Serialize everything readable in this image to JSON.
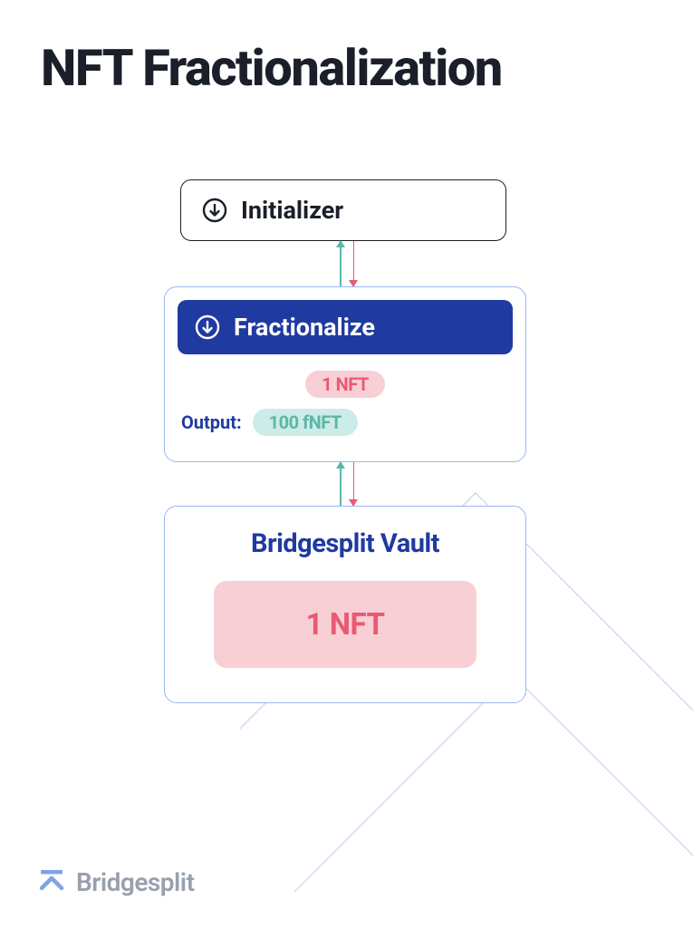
{
  "title": "NFT Fractionalization",
  "initializer": {
    "label": "Initializer"
  },
  "fractionalize": {
    "header_label": "Fractionalize",
    "input_pill": "1 NFT",
    "output_label": "Output:",
    "output_pill": "100 fNFT"
  },
  "vault": {
    "title": "Bridgesplit Vault",
    "nft_label": "1 NFT"
  },
  "footer": {
    "brand": "Bridgesplit"
  },
  "colors": {
    "darkText": "#1a1f29",
    "blue": "#1f3aa0",
    "lightBlueBorder": "#9bb7f0",
    "teal": "#5bb7a6",
    "tealBg": "#cdece7",
    "red": "#eb5972",
    "redBg": "#f8cfd4",
    "gray": "#98a0ac"
  }
}
